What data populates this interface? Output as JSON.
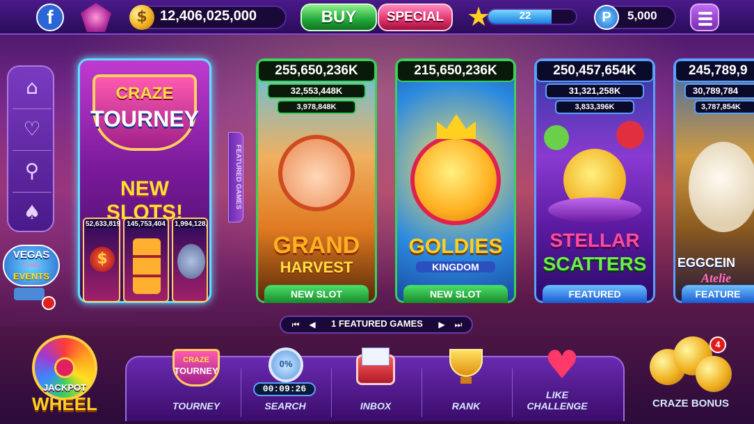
{
  "topbar": {
    "facebook_icon": "facebook-icon",
    "coins": "12,406,025,000",
    "buy_label": "BUY",
    "special_label": "SPECIAL",
    "level": "22",
    "level_progress": 0.72,
    "points": "5,000"
  },
  "left_nav": {
    "items": [
      "home-icon",
      "alarm-heart-icon",
      "search-icon",
      "cards-icon"
    ]
  },
  "vegas_events": {
    "line1": "VEGAS",
    "line2": "Craze",
    "line3": "EVENTS"
  },
  "tourney_card": {
    "line1": "CRAZE",
    "line2": "TOURNEY",
    "banner": "NEW SLOTS!",
    "mini_values": [
      "52,633,819",
      "145,753,404",
      "1,994,128,"
    ]
  },
  "featured_tab": "FEATURED GAMES",
  "games": [
    {
      "jackpot1": "255,650,236K",
      "jackpot2": "32,553,448K",
      "jackpot3": "3,978,848K",
      "title1": "GRAND",
      "title2": "HARVEST",
      "ribbon": "NEW SLOT"
    },
    {
      "jackpot1": "215,650,236K",
      "title1": "GOLDIES",
      "title2": "KINGDOM",
      "ribbon": "NEW SLOT"
    },
    {
      "jackpot1": "250,457,654K",
      "jackpot2": "31,321,258K",
      "jackpot3": "3,833,396K",
      "title1": "STELLAR",
      "title2": "SCATTERS",
      "ribbon": "FEATURED"
    },
    {
      "jackpot1": "245,789,9",
      "jackpot2": "30,789,784",
      "jackpot3": "3,787,854K",
      "title1": "EGGCEIN",
      "title2": "Atelie",
      "ribbon": "FEATURE"
    }
  ],
  "pager": {
    "label": "1 FEATURED GAMES"
  },
  "bottom": {
    "jackpot_line1": "JACKPOT",
    "jackpot_line2": "WHEEL",
    "tourney_icon_line1": "CRAZE",
    "tourney_icon_line2": "TOURNEY",
    "tourney": "TOURNEY",
    "search_percent": "0%",
    "search_timer": "00:09:26",
    "search": "SEARCH",
    "inbox": "INBOX",
    "rank": "RANK",
    "like_challenge": "LIKE CHALLENGE",
    "craze_bonus": "CRAZE BONUS",
    "bonus_badge": "4"
  }
}
